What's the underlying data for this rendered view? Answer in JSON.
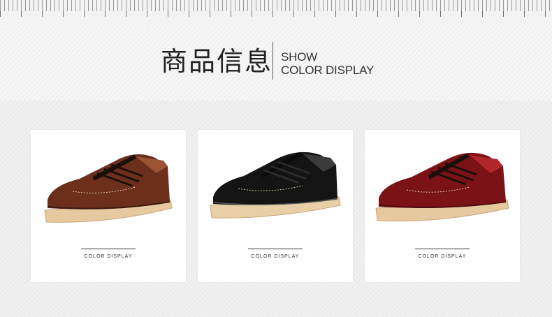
{
  "header": {
    "title_cn": "商品信息",
    "title_en_line1": "SHOW",
    "title_en_line2": "COLOR DISPLAY"
  },
  "products": [
    {
      "caption": "COLOR DISPLAY",
      "color_name": "brown",
      "upper": "#6b2f1b",
      "upper_hi": "#9a5434",
      "sole": "#e6c99e"
    },
    {
      "caption": "COLOR DISPLAY",
      "color_name": "black",
      "upper": "#141414",
      "upper_hi": "#3b3b3b",
      "sole": "#e9cfa6"
    },
    {
      "caption": "COLOR DISPLAY",
      "color_name": "red",
      "upper": "#7a1216",
      "upper_hi": "#b0262a",
      "sole": "#e6c99e"
    }
  ]
}
